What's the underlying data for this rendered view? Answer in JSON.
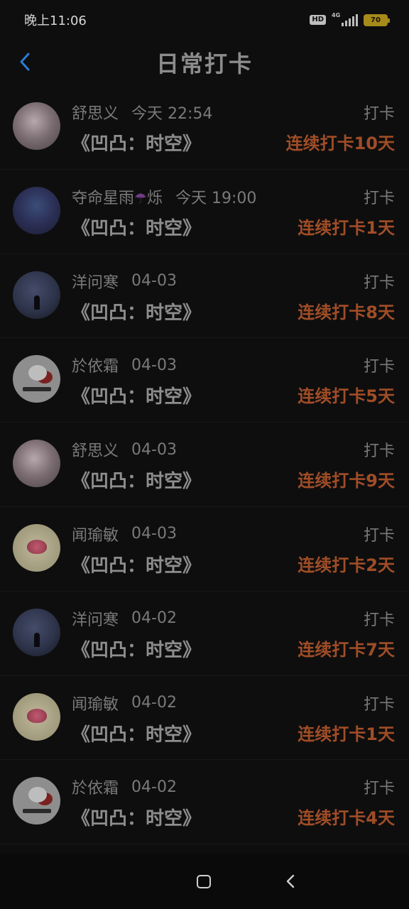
{
  "status": {
    "time": "晚上11:06",
    "hd": "HD",
    "network": "4G",
    "battery": "70"
  },
  "header": {
    "title": "日常打卡"
  },
  "entries": [
    {
      "name": "舒思义",
      "time": "今天 22:54",
      "book": "《凹凸：时空》",
      "action": "打卡",
      "streak": "连续打卡10天",
      "avatar": "blush"
    },
    {
      "name": "夺命星雨",
      "name_suffix": "烁",
      "emoji": "☂",
      "time": "今天 19:00",
      "book": "《凹凸：时空》",
      "action": "打卡",
      "streak": "连续打卡1天",
      "avatar": "anime"
    },
    {
      "name": "洋问寒",
      "time": "04-03",
      "book": "《凹凸：时空》",
      "action": "打卡",
      "streak": "连续打卡8天",
      "avatar": "moon"
    },
    {
      "name": "於依霜",
      "time": "04-03",
      "book": "《凹凸：时空》",
      "action": "打卡",
      "streak": "连续打卡5天",
      "avatar": "panda"
    },
    {
      "name": "舒思义",
      "time": "04-03",
      "book": "《凹凸：时空》",
      "action": "打卡",
      "streak": "连续打卡9天",
      "avatar": "blush"
    },
    {
      "name": "闻瑜敏",
      "time": "04-03",
      "book": "《凹凸：时空》",
      "action": "打卡",
      "streak": "连续打卡2天",
      "avatar": "rose"
    },
    {
      "name": "洋问寒",
      "time": "04-02",
      "book": "《凹凸：时空》",
      "action": "打卡",
      "streak": "连续打卡7天",
      "avatar": "moon"
    },
    {
      "name": "闻瑜敏",
      "time": "04-02",
      "book": "《凹凸：时空》",
      "action": "打卡",
      "streak": "连续打卡1天",
      "avatar": "rose"
    },
    {
      "name": "於依霜",
      "time": "04-02",
      "book": "《凹凸：时空》",
      "action": "打卡",
      "streak": "连续打卡4天",
      "avatar": "panda"
    }
  ],
  "colors": {
    "streak": "#a04d27",
    "accent_back": "#2c7bd6"
  }
}
